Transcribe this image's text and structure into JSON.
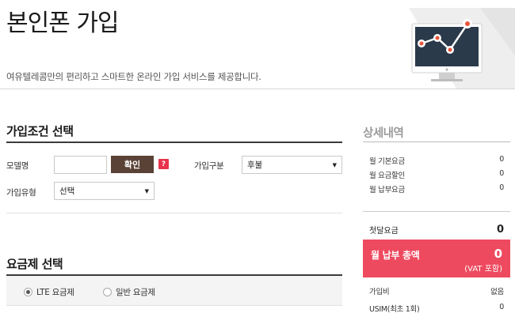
{
  "header": {
    "title": "본인폰 가입",
    "description": "여유텔레콤만의 편리하고 스마트한 온라인 가입 서비스를 제공합니다."
  },
  "colors": {
    "accent_brown": "#5b4236",
    "accent_red": "#ee4a5f",
    "help_red": "#e8334a",
    "monitor_dark": "#2a3a4a",
    "chart_node": "#e8553a"
  },
  "conditions": {
    "title": "가입조건 선택",
    "model_label": "모델명",
    "model_value": "",
    "confirm_label": "확인",
    "help_label": "?",
    "join_type_label": "가입구분",
    "join_type_value": "후불",
    "join_kind_label": "가입유형",
    "join_kind_value": "선택"
  },
  "plans": {
    "title": "요금제 선택",
    "options": [
      {
        "label": "LTE 요금제",
        "selected": true
      },
      {
        "label": "일반 요금제",
        "selected": false
      }
    ]
  },
  "summary": {
    "title": "상세내역",
    "rows": [
      {
        "label": "월 기본요금",
        "value": "0"
      },
      {
        "label": "월 요금할인",
        "value": "0"
      },
      {
        "label": "월 납부요금",
        "value": "0"
      }
    ],
    "first_fee_label": "첫달요금",
    "first_fee_value": "0",
    "total_label": "월 납부 총액",
    "total_value": "0",
    "total_vat": "(VAT 포함)",
    "extra_rows": [
      {
        "label": "가입비",
        "value": "없음"
      },
      {
        "label": "USIM(최초 1회)",
        "value": "0"
      }
    ]
  }
}
